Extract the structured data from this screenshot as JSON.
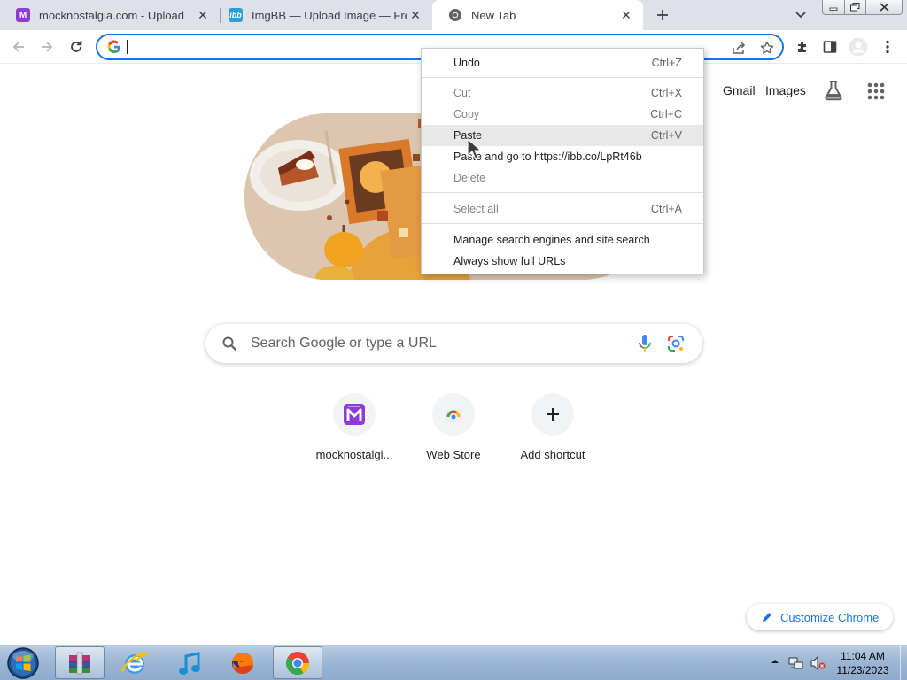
{
  "browser": {
    "tabs": [
      {
        "title": "mocknostalgia.com - Upload",
        "favicon": "mocknostalgia-favicon",
        "active": false
      },
      {
        "title": "ImgBB — Upload Image — Free I",
        "favicon": "imgbb-favicon",
        "active": false
      },
      {
        "title": "New Tab",
        "favicon": "chrome-favicon",
        "active": true
      }
    ],
    "omnibox": {
      "value": "",
      "placeholder": ""
    }
  },
  "newtab": {
    "top_links": {
      "gmail": "Gmail",
      "images": "Images"
    },
    "search_placeholder": "Search Google or type a URL",
    "shortcuts": [
      {
        "label": "mocknostalgi...",
        "icon": "mocknostalgia-icon"
      },
      {
        "label": "Web Store",
        "icon": "webstore-icon"
      },
      {
        "label": "Add shortcut",
        "icon": "plus-icon"
      }
    ],
    "customize_label": "Customize Chrome"
  },
  "context_menu": {
    "items": [
      {
        "label": "Undo",
        "shortcut": "Ctrl+Z",
        "enabled": true
      },
      {
        "label": "Cut",
        "shortcut": "Ctrl+X",
        "enabled": false
      },
      {
        "label": "Copy",
        "shortcut": "Ctrl+C",
        "enabled": false
      },
      {
        "label": "Paste",
        "shortcut": "Ctrl+V",
        "enabled": true,
        "highlighted": true
      },
      {
        "label": "Paste and go to https://ibb.co/LpRt46b",
        "shortcut": "",
        "enabled": true
      },
      {
        "label": "Delete",
        "shortcut": "",
        "enabled": false
      },
      {
        "label": "Select all",
        "shortcut": "Ctrl+A",
        "enabled": false
      },
      {
        "label": "Manage search engines and site search",
        "shortcut": "",
        "enabled": true
      },
      {
        "label": "Always show full URLs",
        "shortcut": "",
        "enabled": true
      }
    ]
  },
  "taskbar": {
    "apps": [
      "winrar-icon",
      "internet-explorer-icon",
      "itunes-icon",
      "firefox-icon",
      "chrome-icon"
    ],
    "clock_time": "11:04 AM",
    "clock_date": "11/23/2023"
  },
  "colors": {
    "accent": "#1a73e8",
    "tabstrip": "#dee1e6",
    "taskbar": "#9db7d4"
  }
}
